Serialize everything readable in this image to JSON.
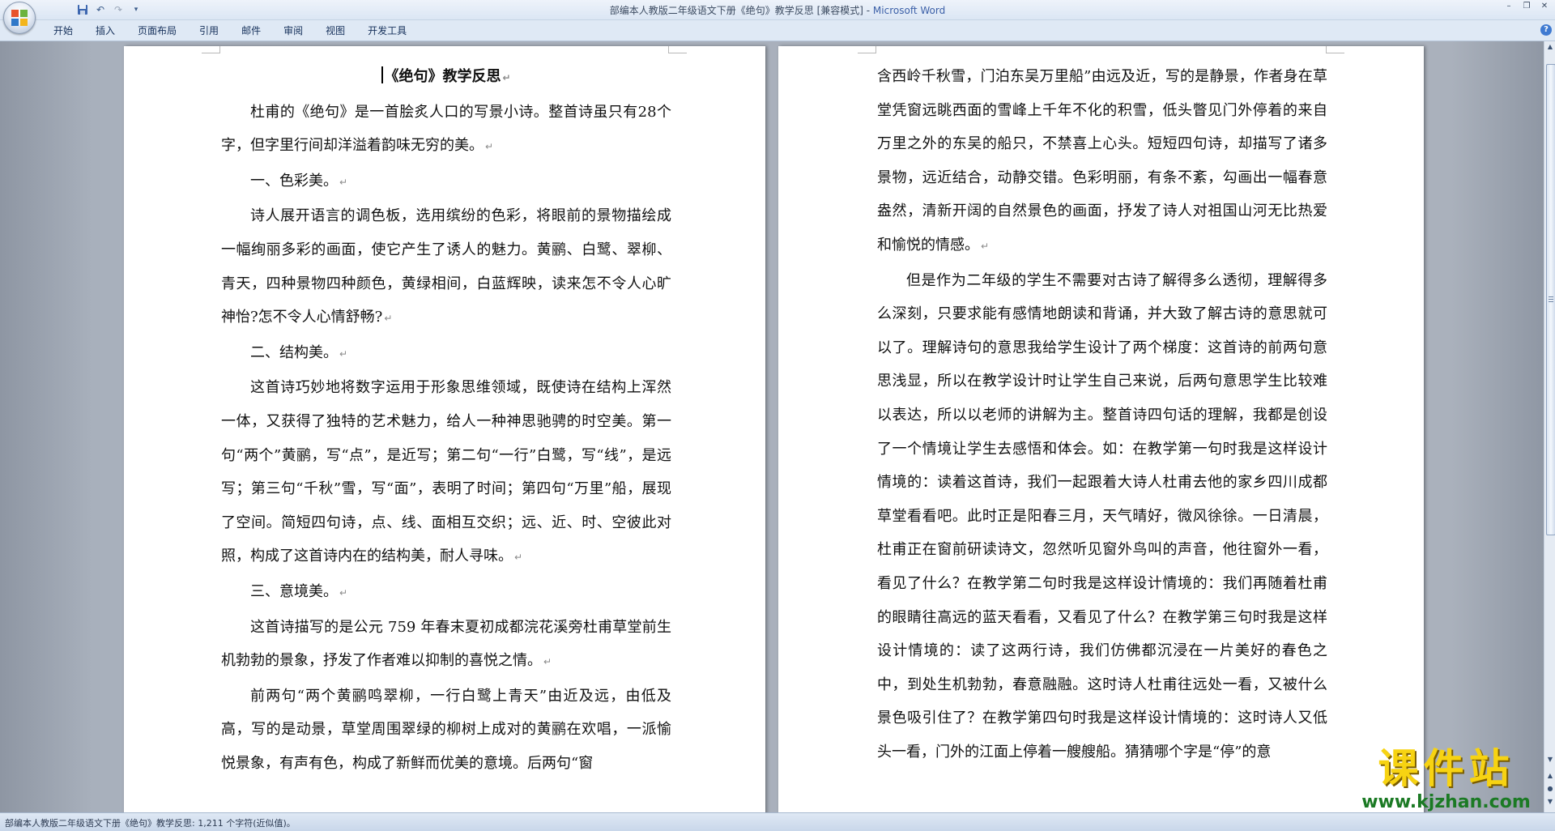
{
  "window": {
    "title_doc": "部编本人教版二年级语文下册《绝句》教学反思 [兼容模式] - ",
    "title_app": "Microsoft Word",
    "controls": {
      "minimize": "–",
      "restore": "❐",
      "close": "✕"
    }
  },
  "quick_access": {
    "save_icon": "💾",
    "undo_icon": "↶",
    "redo_icon": "↷",
    "customize_icon": "▾"
  },
  "ribbon": {
    "tabs": [
      "开始",
      "插入",
      "页面布局",
      "引用",
      "邮件",
      "审阅",
      "视图",
      "开发工具"
    ],
    "help_label": "?"
  },
  "paragraph_mark": "↵",
  "document": {
    "title": "《绝句》教学反思",
    "page1": [
      {
        "text": "杜甫的《绝句》是一首脍炙人口的写景小诗。整首诗虽只有28个字，但字里行间却洋溢着韵味无穷的美。",
        "indent": true
      },
      {
        "text": "一、色彩美。",
        "indent": true
      },
      {
        "text": "诗人展开语言的调色板，选用缤纷的色彩，将眼前的景物描绘成一幅绚丽多彩的画面，使它产生了诱人的魅力。黄鹂、白鹭、翠柳、青天，四种景物四种颜色，黄绿相间，白蓝辉映，读来怎不令人心旷神怡?怎不令人心情舒畅?",
        "indent": true
      },
      {
        "text": "二、结构美。",
        "indent": true
      },
      {
        "text": "这首诗巧妙地将数字运用于形象思维领域，既使诗在结构上浑然一体，又获得了独特的艺术魅力，给人一种神思驰骋的时空美。第一句“两个”黄鹂，写“点”，是近写；第二句“一行”白鹭，写“线”，是远写；第三句“千秋”雪，写“面”，表明了时间；第四句“万里”船，展现了空间。简短四句诗，点、线、面相互交织；远、近、时、空彼此对照，构成了这首诗内在的结构美，耐人寻味。",
        "indent": true
      },
      {
        "text": "三、意境美。",
        "indent": true
      },
      {
        "text": "这首诗描写的是公元 759 年春末夏初成都浣花溪旁杜甫草堂前生机勃勃的景象，抒发了作者难以抑制的喜悦之情。",
        "indent": true
      },
      {
        "text": "前两句“两个黄鹂鸣翠柳，一行白鹭上青天”由近及远，由低及高，写的是动景，草堂周围翠绿的柳树上成对的黄鹂在欢唱，一派愉悦景象，有声有色，构成了新鲜而优美的意境。后两句“窗",
        "indent": true,
        "continues": true
      }
    ],
    "page2": [
      {
        "text": "含西岭千秋雪，门泊东吴万里船”由远及近，写的是静景，作者身在草堂凭窗远眺西面的雪峰上千年不化的积雪，低头瞥见门外停着的来自万里之外的东吴的船只，不禁喜上心头。短短四句诗，却描写了诸多景物，远近结合，动静交错。色彩明丽，有条不紊，勾画出一幅春意盎然，清新开阔的自然景色的画面，抒发了诗人对祖国山河无比热爱和愉悦的情感。",
        "indent": false
      },
      {
        "text": "但是作为二年级的学生不需要对古诗了解得多么透彻，理解得多么深刻，只要求能有感情地朗读和背诵，并大致了解古诗的意思就可以了。理解诗句的意思我给学生设计了两个梯度：这首诗的前两句意思浅显，所以在教学设计时让学生自己来说，后两句意思学生比较难以表达，所以以老师的讲解为主。整首诗四句话的理解，我都是创设了一个情境让学生去感悟和体会。如：在教学第一句时我是这样设计情境的：读着这首诗，我们一起跟着大诗人杜甫去他的家乡四川成都草堂看看吧。此时正是阳春三月，天气晴好，微风徐徐。一日清晨，杜甫正在窗前研读诗文，忽然听见窗外鸟叫的声音，他往窗外一看，看见了什么？在教学第二句时我是这样设计情境的：我们再随着杜甫的眼睛往高远的蓝天看看，又看见了什么？在教学第三句时我是这样设计情境的：读了这两行诗，我们仿佛都沉浸在一片美好的春色之中，到处生机勃勃，春意融融。这时诗人杜甫往远处一看，又被什么景色吸引住了？在教学第四句时我是这样设计情境的：这时诗人又低头一看，门外的江面上停着一艘艘船。猜猜哪个字是“停”的意",
        "indent": true,
        "continues": true
      }
    ]
  },
  "status": {
    "text": "部编本人教版二年级语文下册《绝句》教学反思: 1,211 个字符(近似值)。"
  },
  "watermark": {
    "text": "课件站",
    "url": "www.kjzhan.com"
  },
  "colors": {
    "title_app": "#3c60a8",
    "workspace": "#a9b0bb",
    "watermark_yellow": "#f7d312",
    "watermark_green": "#1b7a24"
  }
}
